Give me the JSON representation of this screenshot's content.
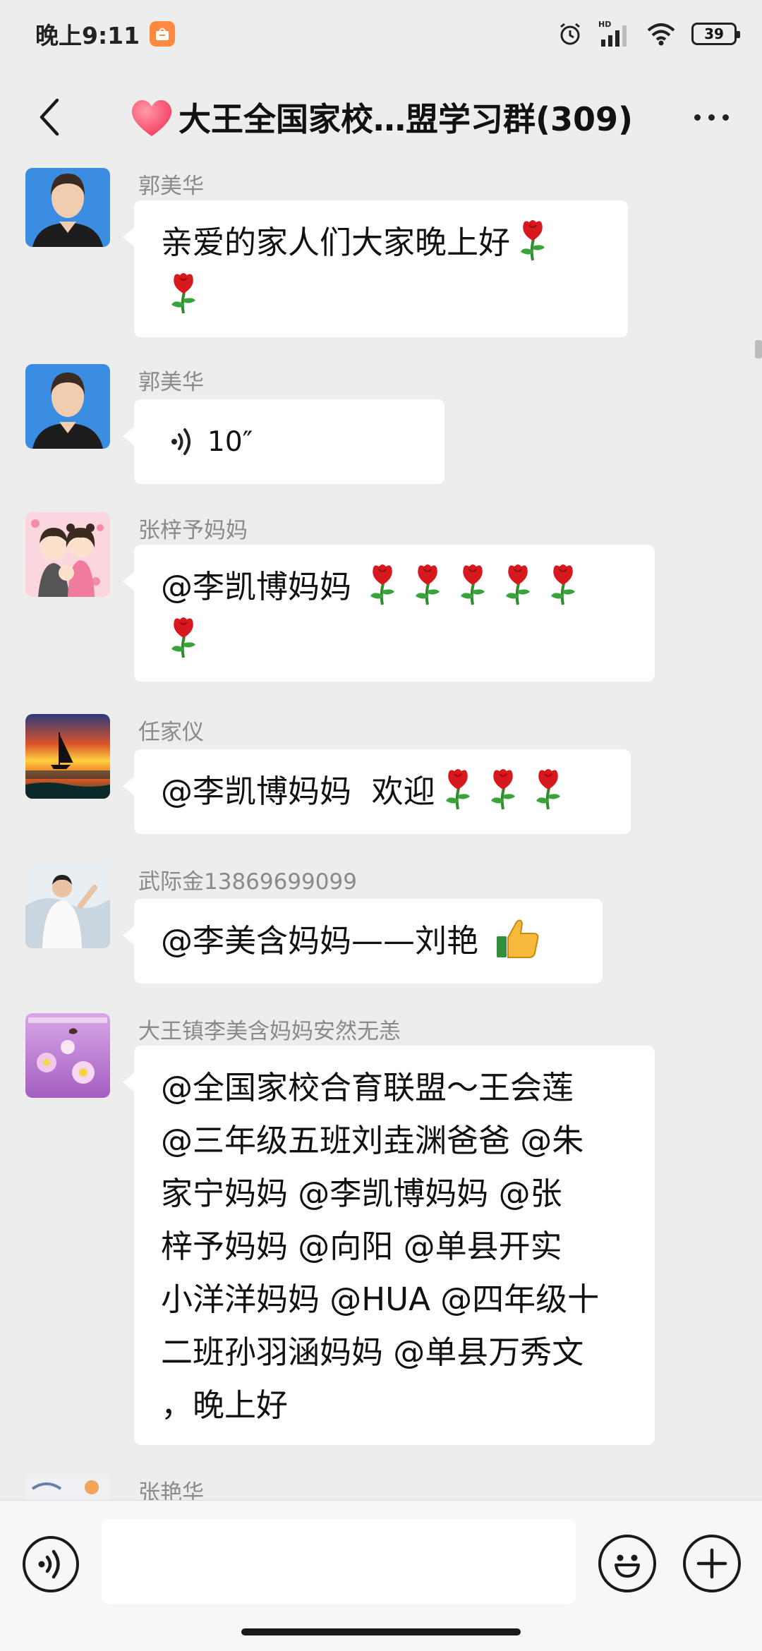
{
  "status_bar": {
    "time": "晚上9:11",
    "battery": "39",
    "network_badge": "HD"
  },
  "header": {
    "title": "大王全国家校…盟学习群(309)",
    "heart_icon": "heart-icon",
    "back_icon": "back-chevron-icon",
    "more_icon": "more-dots-icon"
  },
  "messages": [
    {
      "sender": "郭美华",
      "type": "text",
      "text": "亲爱的家人们大家晚上好",
      "roses": 2
    },
    {
      "sender": "郭美华",
      "type": "voice",
      "duration": "10″"
    },
    {
      "sender": "张梓予妈妈",
      "type": "text",
      "text": "@李凯博妈妈",
      "roses": 6
    },
    {
      "sender": "任家仪",
      "type": "text",
      "text": "@李凯博妈妈  欢迎",
      "roses": 3
    },
    {
      "sender": "武际金13869699099",
      "type": "text",
      "text": "@李美含妈妈——刘艳",
      "emoji": "thumbs-up"
    },
    {
      "sender": "大王镇李美含妈妈安然无恙",
      "type": "text",
      "lines": [
        "@全国家校合育联盟～王会莲",
        "@三年级五班刘垚渊爸爸 @朱",
        "家宁妈妈 @李凯博妈妈 @张",
        "梓予妈妈 @向阳 @单县开实",
        "小洋洋妈妈 @HUA @四年级十",
        "二班孙羽涵妈妈 @单县万秀文",
        "，晚上好"
      ]
    },
    {
      "sender": "张艳华",
      "type": "partial"
    }
  ],
  "input_bar": {
    "placeholder": "",
    "voice_icon": "voice-input-icon",
    "emoji_icon": "emoji-icon",
    "plus_icon": "plus-icon"
  },
  "colors": {
    "background": "#ededed",
    "bubble": "#ffffff",
    "sender_name": "#8a8a8a",
    "rose": "#d7191f",
    "heart": "#ff4d6a"
  }
}
